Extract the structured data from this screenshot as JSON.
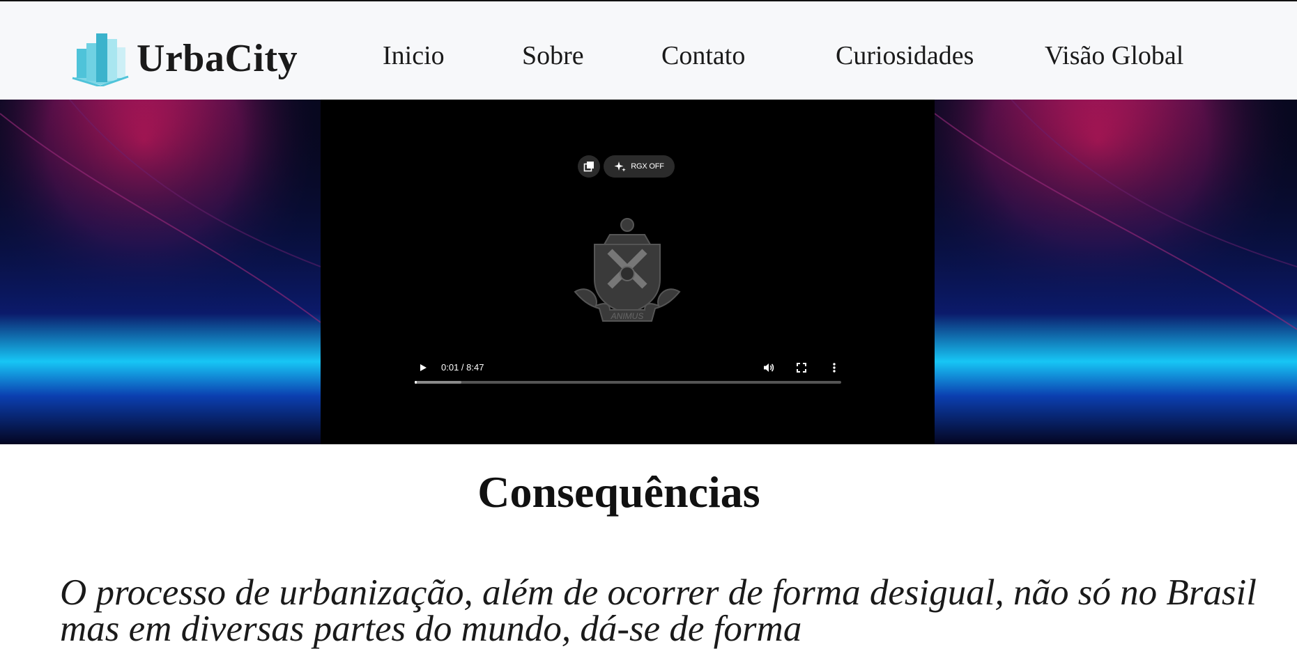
{
  "brand": {
    "name": "UrbaCity",
    "logo_icon": "city-buildings-icon",
    "accent": "#4fc3d9"
  },
  "nav": {
    "items": [
      {
        "label": "Inicio"
      },
      {
        "label": "Sobre"
      },
      {
        "label": "Contato"
      },
      {
        "label": "Curiosidades"
      },
      {
        "label": "Visão Global"
      }
    ]
  },
  "video": {
    "time": "0:01 / 8:47",
    "rgx_label": "RGX OFF",
    "crest_motto": "ANIMUS",
    "progress_fraction": 0.0019,
    "buffered_fraction": 0.11,
    "icons": [
      "pip-icon",
      "sparkle-icon",
      "play-icon",
      "volume-icon",
      "fullscreen-icon",
      "more-vert-icon"
    ]
  },
  "section": {
    "title": "Consequências",
    "paragraph": "O processo de urbanização, além de ocorrer de forma desigual, não só no Brasil mas em diversas partes do mundo, dá-se de forma"
  },
  "colors": {
    "hero_magenta": "#c2185b",
    "hero_blue": "#17c6f5",
    "header_bg": "#f7f8fa"
  }
}
